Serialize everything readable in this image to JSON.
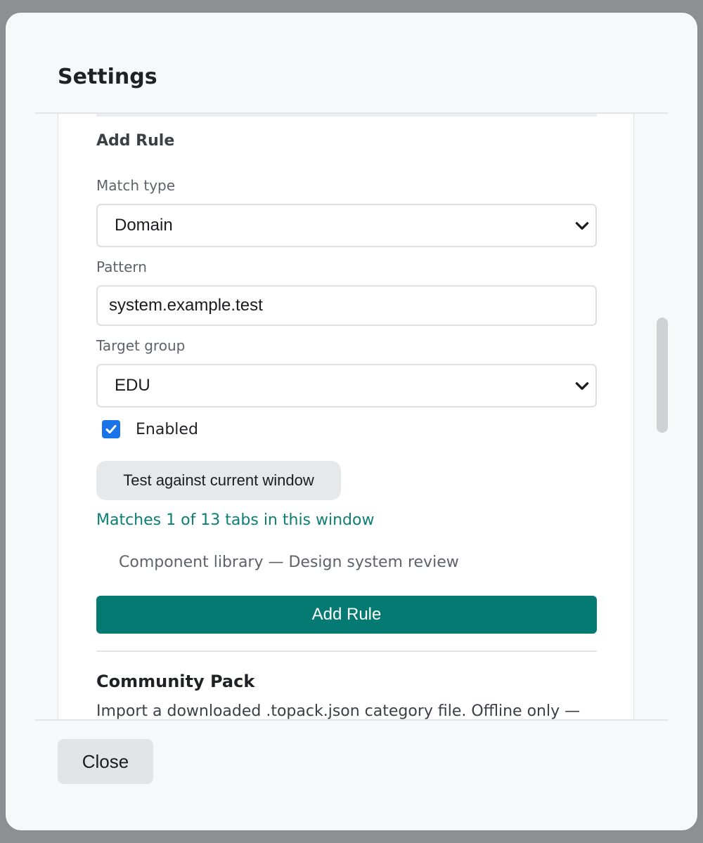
{
  "dialog": {
    "title": "Settings"
  },
  "add_rule": {
    "heading": "Add Rule",
    "match_type": {
      "label": "Match type",
      "value": "Domain"
    },
    "pattern": {
      "label": "Pattern",
      "value": "system.example.test"
    },
    "target_group": {
      "label": "Target group",
      "value": "EDU"
    },
    "enabled": {
      "label": "Enabled",
      "checked": true
    },
    "test_button_label": "Test against current window",
    "match_status": "Matches 1 of 13 tabs in this window",
    "matched_tabs": [
      "Component library — Design system review"
    ],
    "submit_label": "Add Rule"
  },
  "community_pack": {
    "heading": "Community Pack",
    "description": "Import a downloaded .topack.json category file. Offline only —"
  },
  "footer": {
    "close_label": "Close"
  },
  "colors": {
    "accent": "#047a72",
    "match_text": "#0b7f74",
    "checkbox": "#1a73e8"
  },
  "icons": {
    "select_arrow": "chevron-down-icon",
    "checkbox_mark": "checkmark-icon"
  }
}
